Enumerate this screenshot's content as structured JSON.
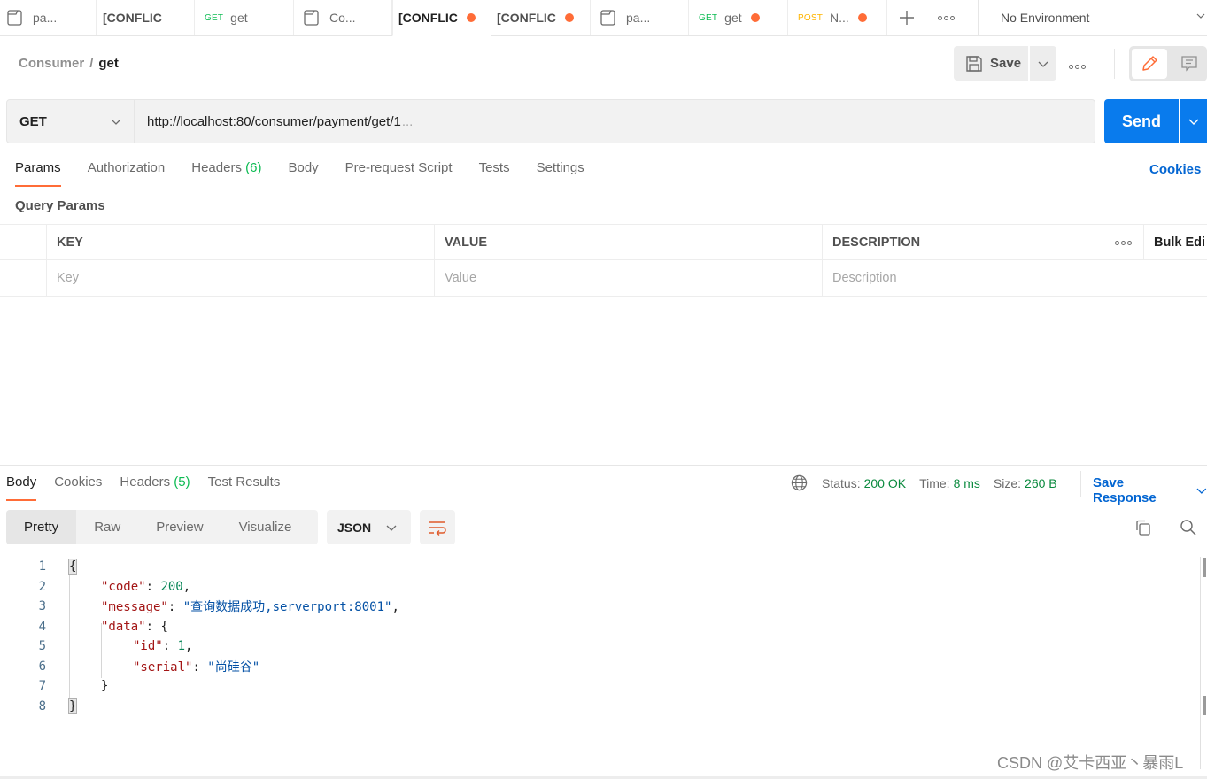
{
  "tabs": [
    {
      "type": "doc",
      "label": "pa...",
      "unsaved": false
    },
    {
      "type": "conflict",
      "label": "[CONFLIC",
      "unsaved": false
    },
    {
      "type": "request",
      "method": "GET",
      "label": "get",
      "unsaved": false
    },
    {
      "type": "doc",
      "label": "Co...",
      "unsaved": false
    },
    {
      "type": "conflict",
      "label": "[CONFLIC",
      "unsaved": true,
      "active": true
    },
    {
      "type": "conflict",
      "label": "[CONFLIC",
      "unsaved": true
    },
    {
      "type": "doc",
      "label": "pa...",
      "unsaved": false
    },
    {
      "type": "request",
      "method": "GET",
      "label": "get",
      "unsaved": true
    },
    {
      "type": "request",
      "method": "POST",
      "label": "N...",
      "unsaved": true
    }
  ],
  "tabbar": {
    "new_tab_icon": "plus-icon",
    "more_icon": "ellipsis-icon"
  },
  "environment": {
    "label": "No Environment"
  },
  "header": {
    "breadcrumb_parent": "Consumer",
    "breadcrumb_sep": "/",
    "breadcrumb_current": "get",
    "save_label": "Save"
  },
  "request": {
    "method": "GET",
    "url": "http://localhost:80/consumer/payment/get/1",
    "url_ellipsis": "...",
    "send_label": "Send"
  },
  "request_tabs": [
    {
      "label": "Params",
      "active": true
    },
    {
      "label": "Authorization"
    },
    {
      "label": "Headers",
      "count": "(6)"
    },
    {
      "label": "Body"
    },
    {
      "label": "Pre-request Script"
    },
    {
      "label": "Tests"
    },
    {
      "label": "Settings"
    }
  ],
  "cookies_link": "Cookies",
  "query_params": {
    "title": "Query Params",
    "columns": [
      "KEY",
      "VALUE",
      "DESCRIPTION"
    ],
    "bulk_edit": "Bulk Edi",
    "placeholders": {
      "key": "Key",
      "value": "Value",
      "description": "Description"
    }
  },
  "response": {
    "tabs": [
      {
        "label": "Body",
        "active": true
      },
      {
        "label": "Cookies"
      },
      {
        "label": "Headers",
        "count": "(5)"
      },
      {
        "label": "Test Results"
      }
    ],
    "status_label": "Status:",
    "status": "200 OK",
    "time_label": "Time:",
    "time": "8 ms",
    "size_label": "Size:",
    "size": "260 B",
    "save_response": "Save Response",
    "views": [
      "Pretty",
      "Raw",
      "Preview",
      "Visualize"
    ],
    "active_view": "Pretty",
    "format": "JSON",
    "colors": {
      "status_ok": "#0a8a3e",
      "link": "#0265d2",
      "accent": "#ff6c37",
      "send": "#097bed"
    }
  },
  "code_lines": [
    {
      "n": "1"
    },
    {
      "n": "2",
      "key": "\"code\"",
      "value": "200",
      "vtype": "num",
      "trail": ","
    },
    {
      "n": "3",
      "key": "\"message\"",
      "value": "\"查询数据成功,serverport:8001\"",
      "vtype": "str",
      "trail": ","
    },
    {
      "n": "4",
      "key": "\"data\"",
      "value": "{",
      "vtype": "brace"
    },
    {
      "n": "5",
      "key": "\"id\"",
      "value": "1",
      "vtype": "num",
      "trail": ","
    },
    {
      "n": "6",
      "key": "\"serial\"",
      "value": "\"尚硅谷\"",
      "vtype": "str"
    },
    {
      "n": "7",
      "value": "}"
    },
    {
      "n": "8",
      "value": "}"
    }
  ],
  "watermark": "CSDN @艾卡西亚丶暴雨L"
}
